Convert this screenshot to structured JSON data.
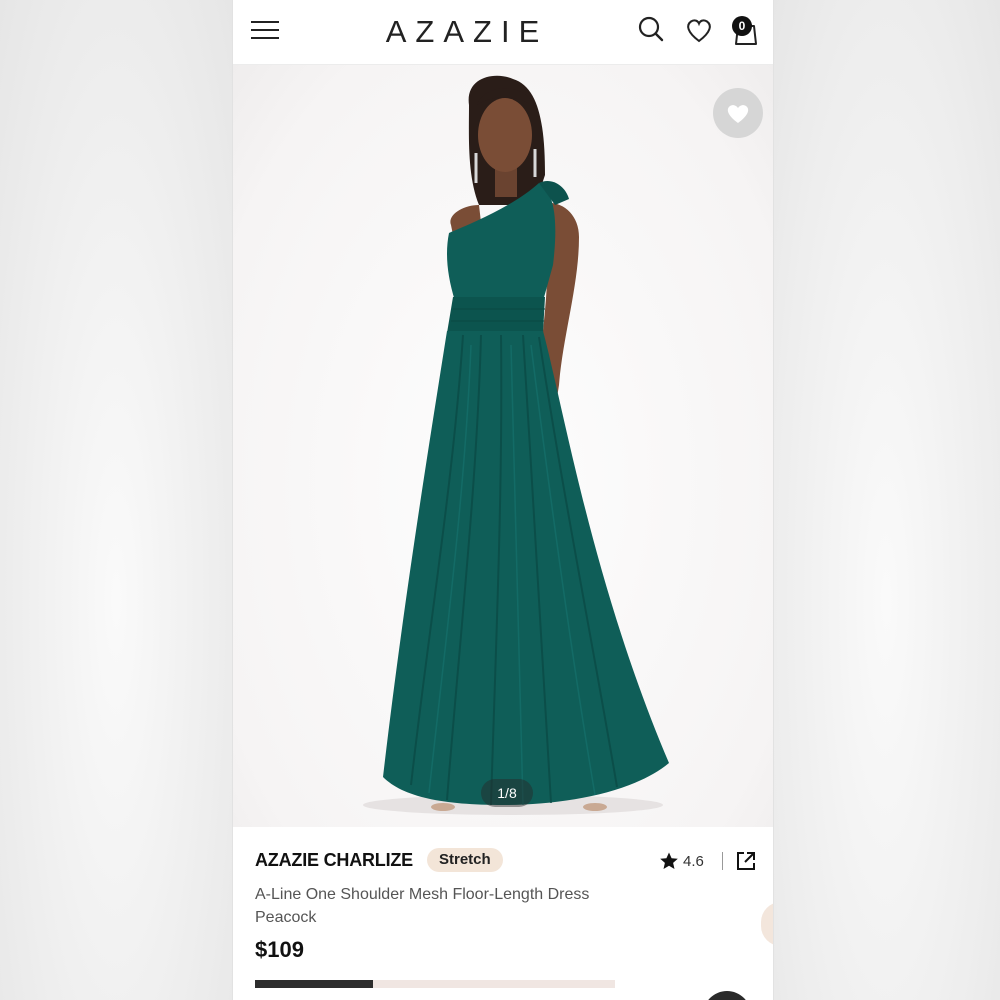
{
  "header": {
    "brand": "AZAZIE",
    "cart_count": "0",
    "icons": [
      "menu-icon",
      "search-icon",
      "heart-icon",
      "shopping-bag-icon"
    ]
  },
  "gallery": {
    "pager": "1/8",
    "current_image": 1,
    "total_images": 8,
    "favorite_icon": "heart-icon"
  },
  "product": {
    "brand_name": "AZAZIE CHARLIZE",
    "badge": "Stretch",
    "rating": "4.6",
    "title_line1": "A-Line One Shoulder Mesh Floor-Length Dress",
    "color_name": "Peacock",
    "price": "$109",
    "rating_icon": "star-icon",
    "share_icon": "share-icon"
  },
  "colors": {
    "dress": "#0f5e58",
    "badge_bg": "#f3e5d8",
    "text_primary": "#111111",
    "text_secondary": "#555555"
  }
}
